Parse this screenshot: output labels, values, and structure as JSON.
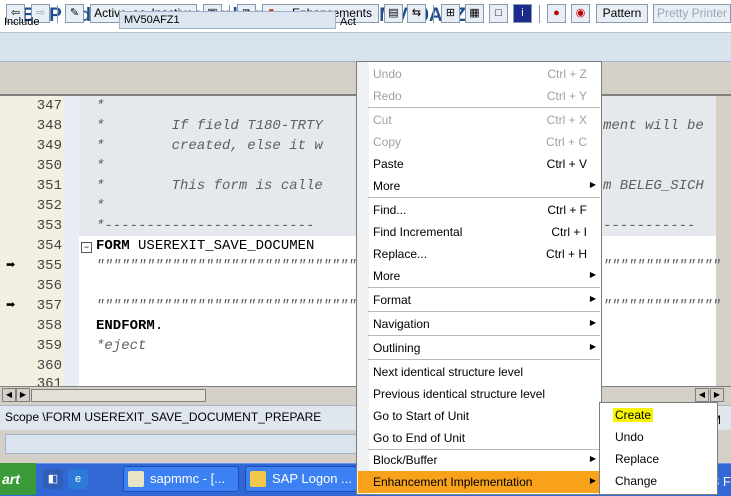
{
  "window": {
    "title": "ABAP Editor: Change Enhancements for MV50AFZ1"
  },
  "toolbar": {
    "toggle_label": "Active <-> Inactive",
    "enhancements_label": "Enhancements",
    "pattern_label": "Pattern",
    "pretty_printer_label": "Pretty Printer"
  },
  "include": {
    "label": "Include",
    "value": "MV50AFZ1",
    "act_label": "Act"
  },
  "editor": {
    "lines": [
      {
        "num": "347",
        "text": "*"
      },
      {
        "num": "348",
        "text": "*        If field T180-TRTY"
      },
      {
        "num": "349",
        "text": "*        created, else it w"
      },
      {
        "num": "350",
        "text": "*"
      },
      {
        "num": "351",
        "text": "*        This form is calle"
      },
      {
        "num": "352",
        "text": "*"
      },
      {
        "num": "353",
        "text": "*-------------------------"
      },
      {
        "num": "354",
        "kw": "FORM",
        "text": " USEREXIT_SAVE_DOCUMEN"
      },
      {
        "num": "355",
        "text": "\"\"\"\"\"\"\"\"\"\"\"\"\"\"\"\"\"\"\"\"\"\"\"\"\"\"\"\"\"\"\"\"\"\"\""
      },
      {
        "num": "356",
        "text": ""
      },
      {
        "num": "357",
        "text": "\"\"\"\"\"\"\"\"\"\"\"\"\"\"\"\"\"\"\"\"\"\"\"\"\"\"\"\"\"\"\"\"\"\"\""
      },
      {
        "num": "358",
        "kw": "ENDFORM",
        "text": "."
      },
      {
        "num": "359",
        "text": "*eject"
      },
      {
        "num": "360",
        "text": ""
      },
      {
        "num": "361",
        "text": ""
      }
    ],
    "right_fragments": {
      "r348": "ment will be",
      "r351": "m BELEG_SICH",
      "r353": "-----------",
      "r355": "\"\"\"\"\"\"\"\"\"\"\"\"\"\"",
      "r357": "\"\"\"\"\"\"\"\"\"\"\"\"\"\""
    }
  },
  "scope": {
    "text": "Scope \\FORM USEREXIT_SAVE_DOCUMENT_PREPARE"
  },
  "context_menu": {
    "items": [
      {
        "label": "Undo",
        "shortcut": "Ctrl + Z",
        "disabled": true
      },
      {
        "label": "Redo",
        "shortcut": "Ctrl + Y",
        "disabled": true
      },
      {
        "label": "Cut",
        "shortcut": "Ctrl + X",
        "disabled": true
      },
      {
        "label": "Copy",
        "shortcut": "Ctrl + C",
        "disabled": true
      },
      {
        "label": "Paste",
        "shortcut": "Ctrl + V"
      },
      {
        "label": "More",
        "submenu": true
      },
      {
        "label": "Find...",
        "shortcut": "Ctrl + F"
      },
      {
        "label": "Find Incremental",
        "shortcut": "Ctrl + I"
      },
      {
        "label": "Replace...",
        "shortcut": "Ctrl + H"
      },
      {
        "label": "More",
        "submenu": true
      },
      {
        "label": "Format",
        "submenu": true
      },
      {
        "label": "Navigation",
        "submenu": true
      },
      {
        "label": "Outlining",
        "submenu": true
      },
      {
        "label": "Next identical structure level"
      },
      {
        "label": "Previous identical structure level"
      },
      {
        "label": "Go to Start of Unit"
      },
      {
        "label": "Go to End of Unit"
      },
      {
        "label": "Block/Buffer",
        "submenu": true
      },
      {
        "label": "Enhancement Implementation",
        "submenu": true,
        "highlighted": true
      }
    ]
  },
  "submenu": {
    "items": [
      "Create",
      "Undo",
      "Replace",
      "Change"
    ]
  },
  "taskbar": {
    "start_label": "art",
    "tasks": [
      {
        "label": "sapmmc - [..."
      },
      {
        "label": "SAP Logon ..."
      }
    ],
    "right_fragment": "3 F",
    "right_fragment_m": "M"
  },
  "colors": {
    "menu_highlight": "#f8a21c",
    "create_highlight": "#f7f500",
    "title_blue": "#1f4e8f"
  }
}
